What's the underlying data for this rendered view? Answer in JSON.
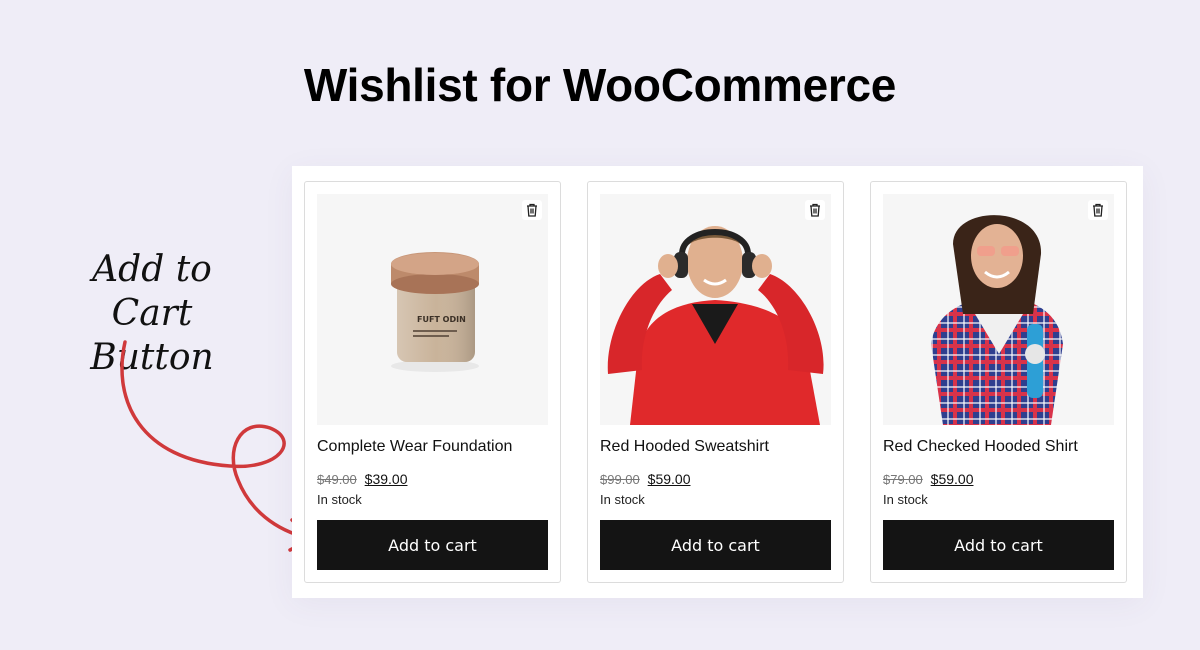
{
  "header": {
    "title": "Wishlist for WooCommerce"
  },
  "annotation": {
    "line1": "Add to Cart",
    "line2": "Button",
    "arrow_color": "#d0393b"
  },
  "products": [
    {
      "name": "Complete Wear Foundation",
      "old_price": "$49.00",
      "price": "$39.00",
      "stock": "In stock",
      "cart_label": "Add to cart",
      "jar_text": "FUFT ODIN",
      "image": "cosmetic-jar"
    },
    {
      "name": "Red Hooded Sweatshirt",
      "old_price": "$99.00",
      "price": "$59.00",
      "stock": "In stock",
      "cart_label": "Add to cart",
      "image": "man-red-hoodie-headphones"
    },
    {
      "name": "Red Checked Hooded Shirt",
      "old_price": "$79.00",
      "price": "$59.00",
      "stock": "In stock",
      "cart_label": "Add to cart",
      "image": "woman-checked-shirt"
    }
  ],
  "colors": {
    "background": "#efedf7",
    "button": "#141414",
    "accent": "#d0393b"
  },
  "icons": {
    "remove": "trash-icon"
  }
}
